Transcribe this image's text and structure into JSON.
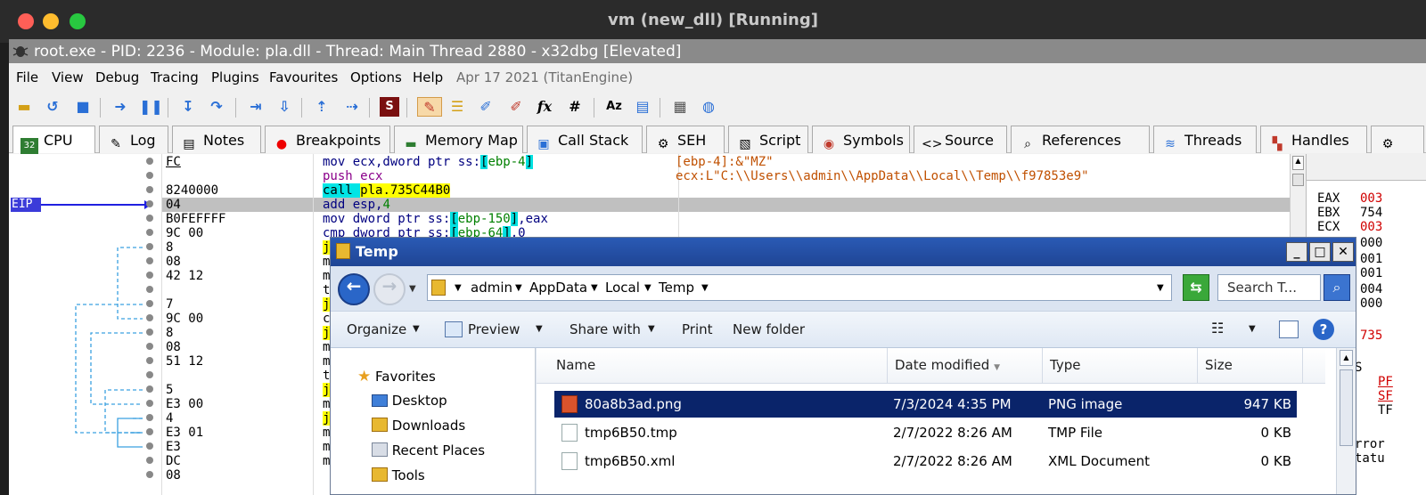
{
  "mac": {
    "title": "vm (new_dll) [Running]",
    "lights": [
      "#ff5f57",
      "#febc2e",
      "#28c840"
    ]
  },
  "x32dbg": {
    "title": "root.exe - PID: 2236 - Module: pla.dll - Thread: Main Thread 2880 - x32dbg [Elevated]",
    "menu": [
      "File",
      "View",
      "Debug",
      "Tracing",
      "Plugins",
      "Favourites",
      "Options",
      "Help"
    ],
    "menu_date": "Apr 17 2021 (TitanEngine)",
    "tabs": [
      {
        "label": "CPU",
        "icon": "cpu-icon"
      },
      {
        "label": "Log",
        "icon": "log-icon"
      },
      {
        "label": "Notes",
        "icon": "notes-icon"
      },
      {
        "label": "Breakpoints",
        "icon": "breakpoint-dot-icon"
      },
      {
        "label": "Memory Map",
        "icon": "memory-icon"
      },
      {
        "label": "Call Stack",
        "icon": "call-stack-icon"
      },
      {
        "label": "SEH",
        "icon": "seh-icon"
      },
      {
        "label": "Script",
        "icon": "script-icon"
      },
      {
        "label": "Symbols",
        "icon": "symbols-icon"
      },
      {
        "label": "Source",
        "icon": "source-icon"
      },
      {
        "label": "References",
        "icon": "references-icon"
      },
      {
        "label": "Threads",
        "icon": "threads-icon"
      },
      {
        "label": "Handles",
        "icon": "handles-icon"
      }
    ],
    "eip_label": "EIP",
    "addr_lines": [
      "FC",
      "",
      "8240000",
      "04",
      "B0FEFFFF",
      "9C 00",
      "8",
      "08",
      "42 12",
      "",
      "7",
      "9C 00",
      "8",
      "08",
      "51 12",
      "",
      "5",
      "E3 00",
      "4",
      "E3 01",
      "E3",
      "DC",
      "08"
    ],
    "disasm": [
      {
        "pre": "mov ecx,dword ptr ss:",
        "br": "[",
        "mid": "ebp-4",
        "br2": "]",
        "post": ""
      },
      {
        "pre": "push ecx",
        "br": "",
        "mid": "",
        "br2": "",
        "post": ""
      },
      {
        "pre": "call ",
        "br": "",
        "mid": "pla.735C44B0",
        "br2": "",
        "post": ""
      },
      {
        "pre": "add esp,",
        "br": "",
        "mid": "4",
        "br2": "",
        "post": ""
      },
      {
        "pre": "mov dword ptr ss:",
        "br": "[",
        "mid": "ebp-150",
        "br2": "]",
        "post": ",eax"
      },
      {
        "pre": "cmp dword ptr ss:",
        "br": "[",
        "mid": "ebp-64",
        "br2": "]",
        "post": ",0"
      }
    ],
    "disasm_partial": [
      "j",
      "m",
      "m",
      "t",
      "j",
      "c",
      "j",
      "m",
      "m",
      "t",
      "j",
      "m",
      "j",
      "m",
      "m",
      "m"
    ],
    "comments": [
      "[ebp-4]:&\"MZ\"",
      "ecx:L\"C:\\\\Users\\\\admin\\\\AppData\\\\Local\\\\Temp\\\\f97853e9\""
    ],
    "registers": [
      {
        "name": "EAX",
        "value": "003",
        "red": true
      },
      {
        "name": "EBX",
        "value": "754",
        "red": false
      },
      {
        "name": "ECX",
        "value": "003",
        "red": true
      },
      {
        "name": "",
        "value": "000",
        "red": false
      },
      {
        "name": "",
        "value": "001",
        "red": false
      },
      {
        "name": "",
        "value": "001",
        "red": false
      },
      {
        "name": "",
        "value": "004",
        "red": false
      },
      {
        "name": "",
        "value": "000",
        "red": false
      },
      {
        "name": "",
        "value": "735",
        "red": true
      }
    ],
    "flags": [
      "PF",
      "SF",
      "TF"
    ],
    "flags_misc": [
      "S",
      "rror",
      "tatu"
    ]
  },
  "explorer": {
    "title": "Temp",
    "breadcrumb": [
      "admin",
      "AppData",
      "Local",
      "Temp"
    ],
    "search_placeholder": "Search T...",
    "commands": [
      "Organize",
      "Preview",
      "Share with",
      "Print",
      "New folder"
    ],
    "nav": [
      {
        "label": "Favorites",
        "icon": "star-icon"
      },
      {
        "label": "Desktop",
        "icon": "desktop-icon"
      },
      {
        "label": "Downloads",
        "icon": "downloads-folder-icon"
      },
      {
        "label": "Recent Places",
        "icon": "recent-places-icon"
      },
      {
        "label": "Tools",
        "icon": "folder-icon"
      }
    ],
    "columns": [
      "Name",
      "Date modified",
      "Type",
      "Size"
    ],
    "files": [
      {
        "name": "80a8b3ad.png",
        "date": "7/3/2024 4:35 PM",
        "type": "PNG image",
        "size": "947 KB",
        "selected": true
      },
      {
        "name": "tmp6B50.tmp",
        "date": "2/7/2022 8:26 AM",
        "type": "TMP File",
        "size": "0 KB",
        "selected": false
      },
      {
        "name": "tmp6B50.xml",
        "date": "2/7/2022 8:26 AM",
        "type": "XML Document",
        "size": "0 KB",
        "selected": false
      }
    ]
  }
}
